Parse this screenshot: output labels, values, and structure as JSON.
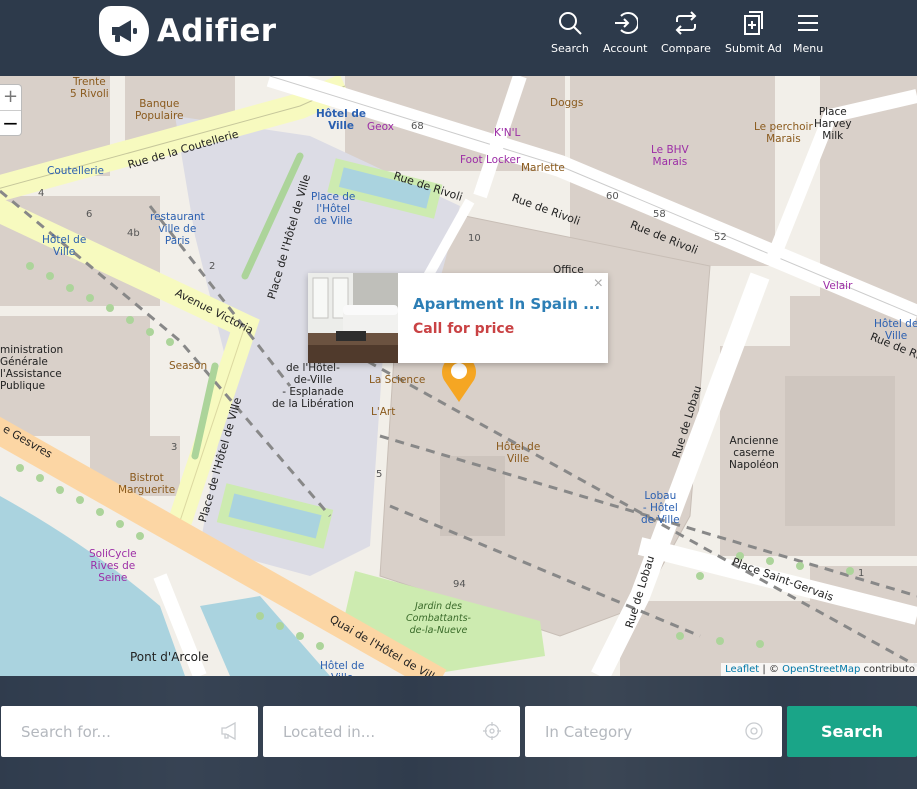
{
  "brand": {
    "name": "Adifier"
  },
  "nav": {
    "search": "Search",
    "account": "Account",
    "compare": "Compare",
    "submit_ad": "Submit Ad",
    "menu": "Menu"
  },
  "map": {
    "zoom_in": "+",
    "zoom_out": "−",
    "attribution": {
      "leaflet": "Leaflet",
      "separator": " | © ",
      "osm": "OpenStreetMap",
      "suffix": " contributo"
    },
    "popup": {
      "title": "Apartment In Spain ...",
      "price": "Call for price",
      "close": "×"
    },
    "labels": {
      "trente": "Trente\n5 Rivoli",
      "banque": "Banque\nPopulaire",
      "coutellerie_st": "Rue de la Coutellerie",
      "coutellerie": "Coutellerie",
      "hotel_ville_metro": "Hôtel de\nVille",
      "geox": "Geox",
      "knl": "K'N'L",
      "foot_locker": "Foot Locker",
      "doggs": "Doggs",
      "marlette": "Marlette",
      "bhv": "Le BHV\nMarais",
      "perchoir": "Le perchoir\nMarais",
      "place_harvey": "Place\nHarvey\nMilk",
      "rue_rivoli_1": "Rue de Rivoli",
      "rue_rivoli_2": "Rue de Rivoli",
      "rue_rivoli_3": "Rue de Rivoli",
      "rue_rivoli_4": "Rue de Rivoli",
      "restaurant": "restaurant\nville de\nParis",
      "hotel_ville_left": "Hôtel de\nVille",
      "place_hotel_ville": "Place de\nl'Hôtel\nde Ville",
      "place_hv_vertical": "Place de l'Hôtel de Ville",
      "avenue_victoria": "Avenue Victoria",
      "office": "Office",
      "velair": "Velair",
      "hotel_ville_right": "Hôtel de\nVille",
      "administration": "ministration\nGénérale\nl'Assistance\nPublique",
      "season": "Season",
      "esplanade": "Pl\nde l'Hôtel-\nde-Ville\n- Esplanade\nde la Libération",
      "la_science": "La Science",
      "l_art": "L'Art",
      "hotel_ville_center": "Hôtel de\nVille",
      "ancienne": "Ancienne\ncaserne\nNapoléon",
      "rue_lobau_1": "Rue de Lobau",
      "rue_lobau_2": "Rue de Lobau",
      "lobau": "Lobau\n- Hôtel\nde Ville",
      "gesvres": "e Gesvres",
      "bistrot": "Bistrot\nMarguerite",
      "place_hv_vertical2": "Place de l'Hôtel de Ville",
      "solicycle": "SoliCycle\nRives de\nSeine",
      "pont_arcole": "Pont d'Arcole",
      "quai": "Quai de l'Hôtel de Ville",
      "jardin": "Jardin des\nCombattants-\nde-la-Nueve",
      "place_st_gervais": "Place Saint-Gervais",
      "hotel_ville_bottom": "Hôtel de\nVille",
      "n68": "68",
      "n60": "60",
      "n58": "58",
      "n52": "52",
      "n10": "10",
      "n4a": "4",
      "n6": "6",
      "n4b": "4b",
      "n2": "2",
      "n1": "1",
      "n3": "3",
      "n5": "5",
      "n94": "94"
    }
  },
  "search": {
    "keyword_placeholder": "Search for...",
    "location_placeholder": "Located in...",
    "category_placeholder": "In Category",
    "button": "Search"
  },
  "colors": {
    "header_bg": "#2d3a4b",
    "accent_green": "#1aa588",
    "link_blue": "#2c7eb5",
    "price_red": "#c94244",
    "marker": "#f5a623"
  }
}
